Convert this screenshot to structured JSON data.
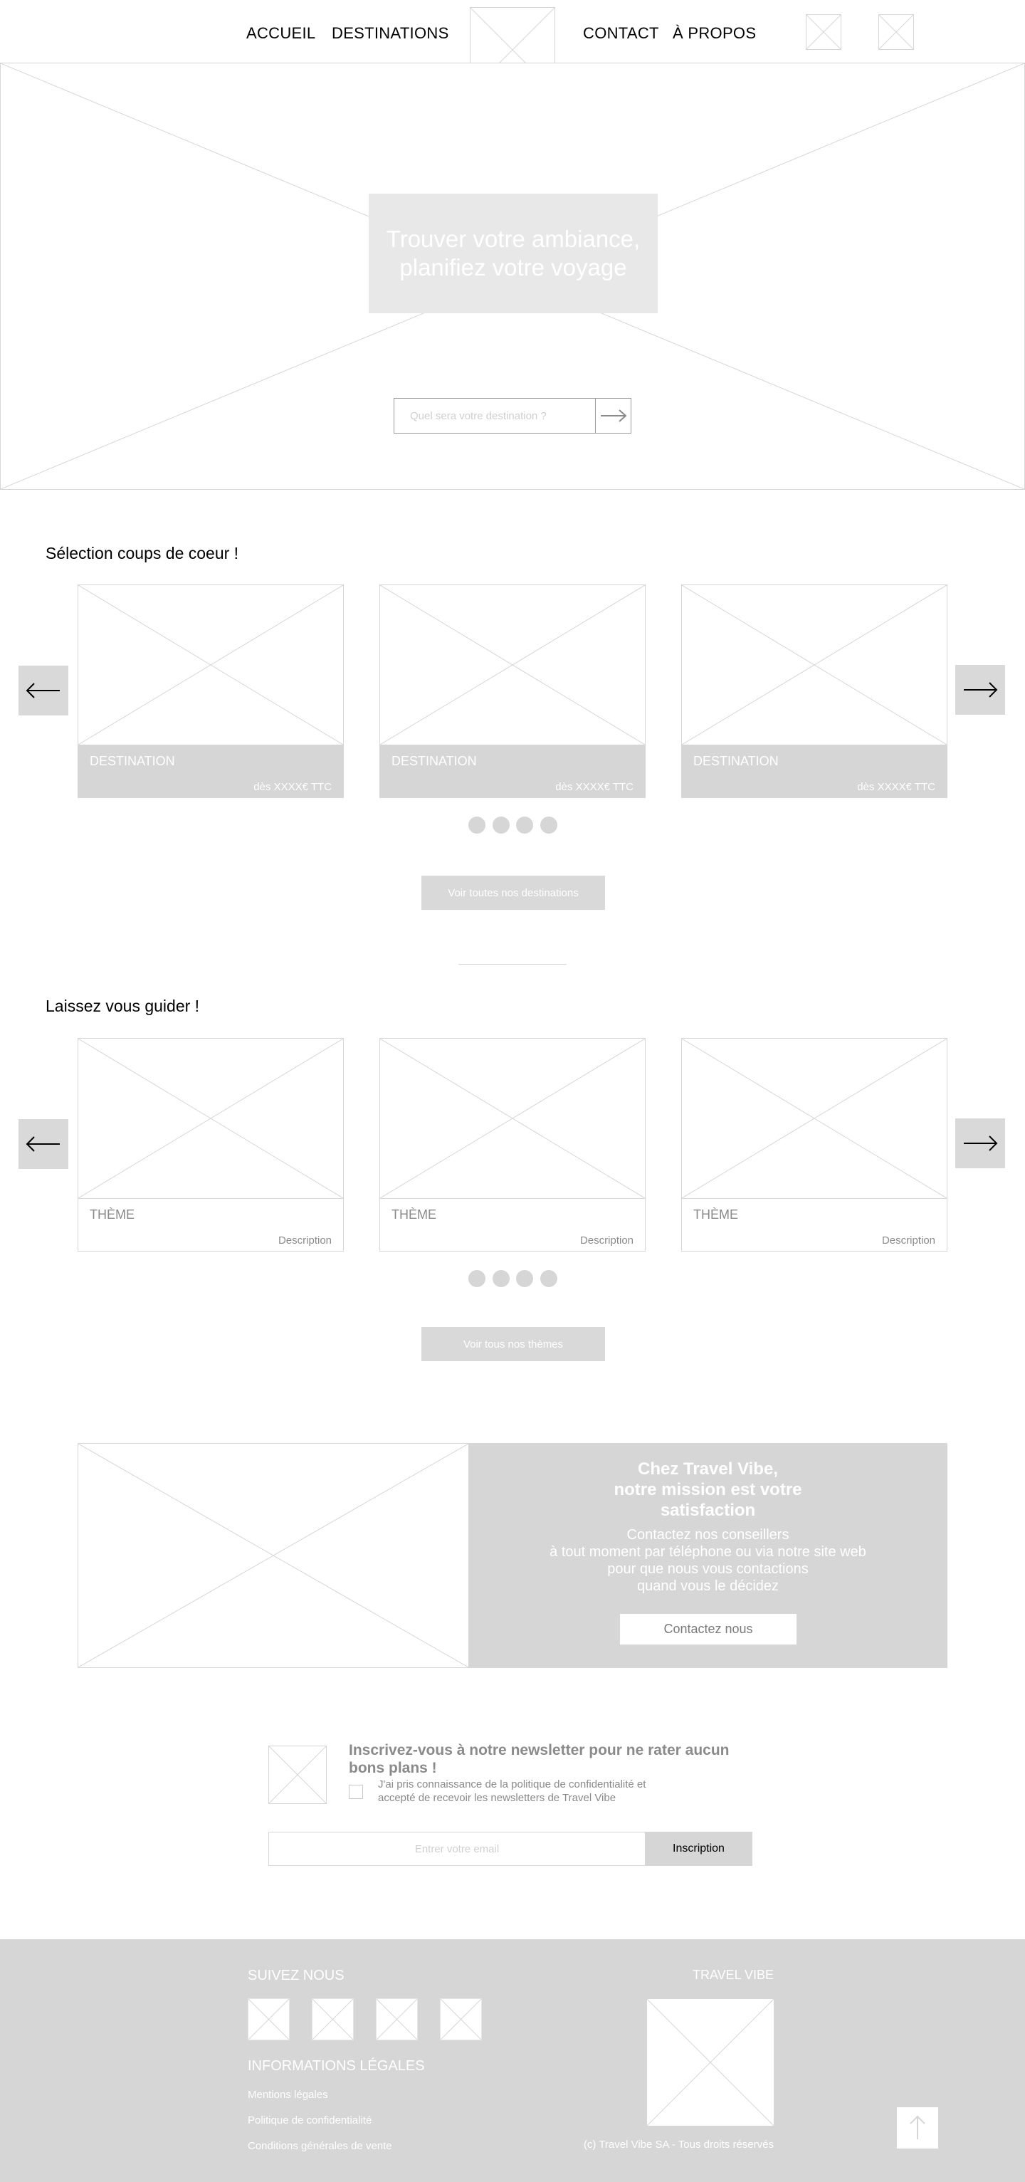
{
  "header": {
    "nav": [
      "ACCUEIL",
      "DESTINATIONS",
      "CONTACT",
      "À PROPOS"
    ],
    "logo_icon": "image-placeholder-icon",
    "icons": [
      "image-placeholder-icon",
      "image-placeholder-icon"
    ]
  },
  "hero": {
    "title": "Trouver votre ambiance,\nplanifiez votre voyage",
    "search_placeholder": "Quel sera votre destination ?",
    "search_icon": "arrow-right-icon"
  },
  "favorites": {
    "title": "Sélection coups de coeur !",
    "cards": [
      {
        "name": "DESTINATION",
        "price": "dès XXXX€ TTC"
      },
      {
        "name": "DESTINATION",
        "price": "dès XXXX€ TTC"
      },
      {
        "name": "DESTINATION",
        "price": "dès XXXX€ TTC"
      }
    ],
    "dots": 4,
    "button": "Voir toutes nos destinations"
  },
  "themes": {
    "title": "Laissez vous guider !",
    "cards": [
      {
        "name": "THÈME",
        "description": "Description"
      },
      {
        "name": "THÈME",
        "description": "Description"
      },
      {
        "name": "THÈME",
        "description": "Description"
      }
    ],
    "dots": 4,
    "button": "Voir tous nos thèmes"
  },
  "mission": {
    "title": "Chez Travel Vibe,\nnotre mission est votre\nsatisfaction",
    "text": "Contactez nos conseillers\nà tout moment par téléphone ou via notre site web\npour que nous vous contactions\nquand vous le décidez",
    "button": "Contactez nous"
  },
  "newsletter": {
    "title": "Inscrivez-vous à notre newsletter pour ne rater aucun bons plans !",
    "consent": "J'ai pris connaissance de la politique de confidentialité et\naccepté de recevoir les newsletters de Travel Vibe",
    "email_placeholder": "Entrer votre email",
    "button": "Inscription"
  },
  "footer": {
    "follow_title": "SUIVEZ NOUS",
    "brand": "TRAVEL VIBE",
    "legal_title": "INFORMATIONS LÉGALES",
    "links": [
      "Mentions légales",
      "Politique de confidentialité",
      "Conditions générales de vente"
    ],
    "copyright": "(c) Travel Vibe SA - Tous droits réservés",
    "to_top_icon": "arrow-up-icon"
  },
  "colors": {
    "placeholder_grey": "#d6d6d6",
    "button_grey": "#d9d9d9",
    "text_grey": "#8a8a8a"
  }
}
